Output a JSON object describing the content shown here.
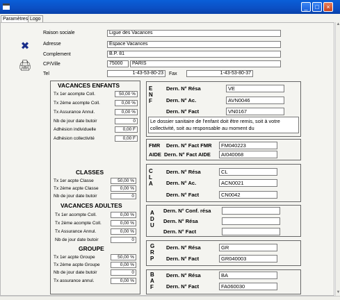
{
  "window": {
    "minimize": "_",
    "maximize": "□",
    "close": "×"
  },
  "tabs": [
    {
      "label": "Paramètres"
    },
    {
      "label": "Logo"
    }
  ],
  "form": {
    "raison_sociale": {
      "label": "Raison sociale",
      "value": "Ligue des Vacances"
    },
    "adresse": {
      "label": "Adresse",
      "value": "Espace Vacances"
    },
    "complement": {
      "label": "Complement",
      "value": "B.P. 81"
    },
    "cpville": {
      "label": "CP/Ville",
      "cp": "75000",
      "ville": "PARIS"
    },
    "tel": {
      "label": "Tel",
      "value": "1-43-53-80-23",
      "fax_label": "Fax",
      "fax_value": "1-43-53-80-37"
    }
  },
  "left_panel": {
    "enfants": {
      "title": "VACANCES ENFANTS",
      "rows": [
        {
          "label": "Tx 1er acompte Coll.",
          "value": "50,00 %"
        },
        {
          "label": "Tx 2ème acompte Coll.",
          "value": "0,00 %"
        },
        {
          "label": "Tx Assurance Annul.",
          "value": "0,00 %"
        },
        {
          "label": "Nb de jour date butoir",
          "value": "0"
        },
        {
          "label": "Adhésion individuelle",
          "value": "0,00 F"
        },
        {
          "label": "Adhésion collectivité",
          "value": "0,00 F"
        }
      ]
    },
    "classes": {
      "title": "CLASSES",
      "rows": [
        {
          "label": "Tx 1er acpte Classe",
          "value": "50,00 %"
        },
        {
          "label": "Tx 2ème acpte Classe",
          "value": "0,00 %"
        },
        {
          "label": "Nb de jour date butoir",
          "value": "0"
        }
      ]
    },
    "adultes": {
      "title": "VACANCES ADULTES",
      "rows": [
        {
          "label": "Tx 1er acompte Coll.",
          "value": "0,00 %"
        },
        {
          "label": "Tx 2ème acompte Coll.",
          "value": "0,00 %"
        },
        {
          "label": "Tx Assurance Annul.",
          "value": "0,00 %"
        },
        {
          "label": "Nb de jour date butoir",
          "value": "0"
        }
      ]
    },
    "groupe": {
      "title": "GROUPE",
      "rows": [
        {
          "label": "Tx 1er acpte Groupe",
          "value": "50,00 %"
        },
        {
          "label": "Tx 2ème acpte Groupe",
          "value": "0,00 %"
        },
        {
          "label": "Nb de jour date butoir",
          "value": "0"
        },
        {
          "label": "Tx assurance annul.",
          "value": "0,00 %"
        }
      ]
    }
  },
  "right": {
    "enf": {
      "letters": "E\nN\nF",
      "resa": {
        "label": "Dern. N° Résa",
        "value": "VE"
      },
      "ac": {
        "label": "Dern. N° Ac.",
        "value": "AVN0046"
      },
      "fact": {
        "label": "Dern. N° Fact",
        "value": "VN0167"
      },
      "note": "Le dossier sanitaire de l'enfant doit être remis, soit à votre collectivité, soit au responsable au moment du"
    },
    "fmr": {
      "fmr_letters": "FMR",
      "aide_letters": "AIDE",
      "fmr": {
        "label": "Dern. N° Fact FMR",
        "value": "FM040223"
      },
      "aide": {
        "label": "Dern. N° Fact AIDE",
        "value": "AI040068"
      }
    },
    "cla": {
      "letters": "C\nL\nA",
      "resa": {
        "label": "Dern. N° Résa",
        "value": "CL"
      },
      "ac": {
        "label": "Dern. N° Ac.",
        "value": "ACN0021"
      },
      "fact": {
        "label": "Dern. N° Fact",
        "value": "CN0042"
      }
    },
    "adu": {
      "letters": "A\nD\nU",
      "conf": {
        "label": "Dern. N° Conf. résa",
        "value": ""
      },
      "resa": {
        "label": "Dern. N° Résa",
        "value": ""
      },
      "fact": {
        "label": "Dern. N° Fact",
        "value": ""
      }
    },
    "grp": {
      "letters": "G\nR\nP",
      "resa": {
        "label": "Dern. N° Résa",
        "value": "GR"
      },
      "fact": {
        "label": "Dern. N° Fact",
        "value": "GR040003"
      }
    },
    "baf": {
      "letters": "B\nA\nF",
      "resa": {
        "label": "Dern. N° Résa",
        "value": "BA"
      },
      "fact": {
        "label": "Dern. N° Fact",
        "value": "FA060030"
      }
    }
  }
}
